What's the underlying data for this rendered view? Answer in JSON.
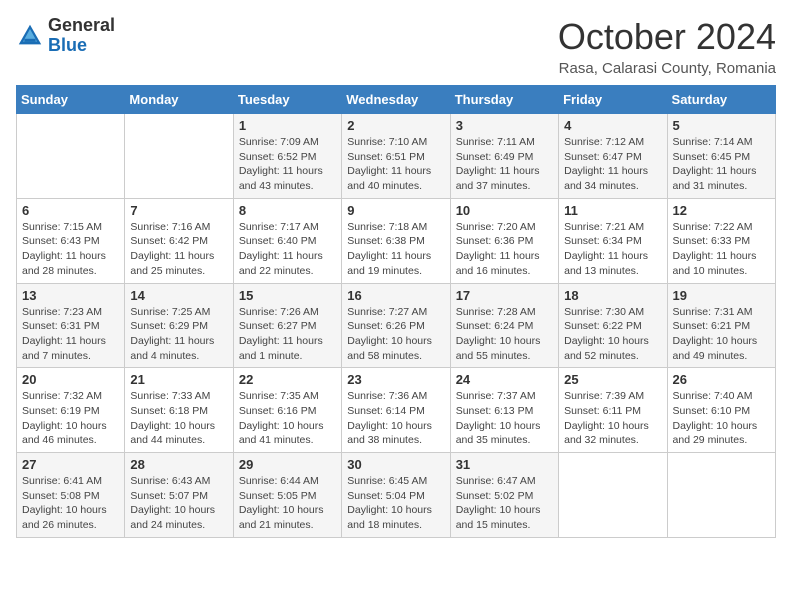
{
  "header": {
    "logo_general": "General",
    "logo_blue": "Blue",
    "month_title": "October 2024",
    "location": "Rasa, Calarasi County, Romania"
  },
  "weekdays": [
    "Sunday",
    "Monday",
    "Tuesday",
    "Wednesday",
    "Thursday",
    "Friday",
    "Saturday"
  ],
  "weeks": [
    [
      {
        "day": "",
        "info": ""
      },
      {
        "day": "",
        "info": ""
      },
      {
        "day": "1",
        "info": "Sunrise: 7:09 AM\nSunset: 6:52 PM\nDaylight: 11 hours and 43 minutes."
      },
      {
        "day": "2",
        "info": "Sunrise: 7:10 AM\nSunset: 6:51 PM\nDaylight: 11 hours and 40 minutes."
      },
      {
        "day": "3",
        "info": "Sunrise: 7:11 AM\nSunset: 6:49 PM\nDaylight: 11 hours and 37 minutes."
      },
      {
        "day": "4",
        "info": "Sunrise: 7:12 AM\nSunset: 6:47 PM\nDaylight: 11 hours and 34 minutes."
      },
      {
        "day": "5",
        "info": "Sunrise: 7:14 AM\nSunset: 6:45 PM\nDaylight: 11 hours and 31 minutes."
      }
    ],
    [
      {
        "day": "6",
        "info": "Sunrise: 7:15 AM\nSunset: 6:43 PM\nDaylight: 11 hours and 28 minutes."
      },
      {
        "day": "7",
        "info": "Sunrise: 7:16 AM\nSunset: 6:42 PM\nDaylight: 11 hours and 25 minutes."
      },
      {
        "day": "8",
        "info": "Sunrise: 7:17 AM\nSunset: 6:40 PM\nDaylight: 11 hours and 22 minutes."
      },
      {
        "day": "9",
        "info": "Sunrise: 7:18 AM\nSunset: 6:38 PM\nDaylight: 11 hours and 19 minutes."
      },
      {
        "day": "10",
        "info": "Sunrise: 7:20 AM\nSunset: 6:36 PM\nDaylight: 11 hours and 16 minutes."
      },
      {
        "day": "11",
        "info": "Sunrise: 7:21 AM\nSunset: 6:34 PM\nDaylight: 11 hours and 13 minutes."
      },
      {
        "day": "12",
        "info": "Sunrise: 7:22 AM\nSunset: 6:33 PM\nDaylight: 11 hours and 10 minutes."
      }
    ],
    [
      {
        "day": "13",
        "info": "Sunrise: 7:23 AM\nSunset: 6:31 PM\nDaylight: 11 hours and 7 minutes."
      },
      {
        "day": "14",
        "info": "Sunrise: 7:25 AM\nSunset: 6:29 PM\nDaylight: 11 hours and 4 minutes."
      },
      {
        "day": "15",
        "info": "Sunrise: 7:26 AM\nSunset: 6:27 PM\nDaylight: 11 hours and 1 minute."
      },
      {
        "day": "16",
        "info": "Sunrise: 7:27 AM\nSunset: 6:26 PM\nDaylight: 10 hours and 58 minutes."
      },
      {
        "day": "17",
        "info": "Sunrise: 7:28 AM\nSunset: 6:24 PM\nDaylight: 10 hours and 55 minutes."
      },
      {
        "day": "18",
        "info": "Sunrise: 7:30 AM\nSunset: 6:22 PM\nDaylight: 10 hours and 52 minutes."
      },
      {
        "day": "19",
        "info": "Sunrise: 7:31 AM\nSunset: 6:21 PM\nDaylight: 10 hours and 49 minutes."
      }
    ],
    [
      {
        "day": "20",
        "info": "Sunrise: 7:32 AM\nSunset: 6:19 PM\nDaylight: 10 hours and 46 minutes."
      },
      {
        "day": "21",
        "info": "Sunrise: 7:33 AM\nSunset: 6:18 PM\nDaylight: 10 hours and 44 minutes."
      },
      {
        "day": "22",
        "info": "Sunrise: 7:35 AM\nSunset: 6:16 PM\nDaylight: 10 hours and 41 minutes."
      },
      {
        "day": "23",
        "info": "Sunrise: 7:36 AM\nSunset: 6:14 PM\nDaylight: 10 hours and 38 minutes."
      },
      {
        "day": "24",
        "info": "Sunrise: 7:37 AM\nSunset: 6:13 PM\nDaylight: 10 hours and 35 minutes."
      },
      {
        "day": "25",
        "info": "Sunrise: 7:39 AM\nSunset: 6:11 PM\nDaylight: 10 hours and 32 minutes."
      },
      {
        "day": "26",
        "info": "Sunrise: 7:40 AM\nSunset: 6:10 PM\nDaylight: 10 hours and 29 minutes."
      }
    ],
    [
      {
        "day": "27",
        "info": "Sunrise: 6:41 AM\nSunset: 5:08 PM\nDaylight: 10 hours and 26 minutes."
      },
      {
        "day": "28",
        "info": "Sunrise: 6:43 AM\nSunset: 5:07 PM\nDaylight: 10 hours and 24 minutes."
      },
      {
        "day": "29",
        "info": "Sunrise: 6:44 AM\nSunset: 5:05 PM\nDaylight: 10 hours and 21 minutes."
      },
      {
        "day": "30",
        "info": "Sunrise: 6:45 AM\nSunset: 5:04 PM\nDaylight: 10 hours and 18 minutes."
      },
      {
        "day": "31",
        "info": "Sunrise: 6:47 AM\nSunset: 5:02 PM\nDaylight: 10 hours and 15 minutes."
      },
      {
        "day": "",
        "info": ""
      },
      {
        "day": "",
        "info": ""
      }
    ]
  ]
}
